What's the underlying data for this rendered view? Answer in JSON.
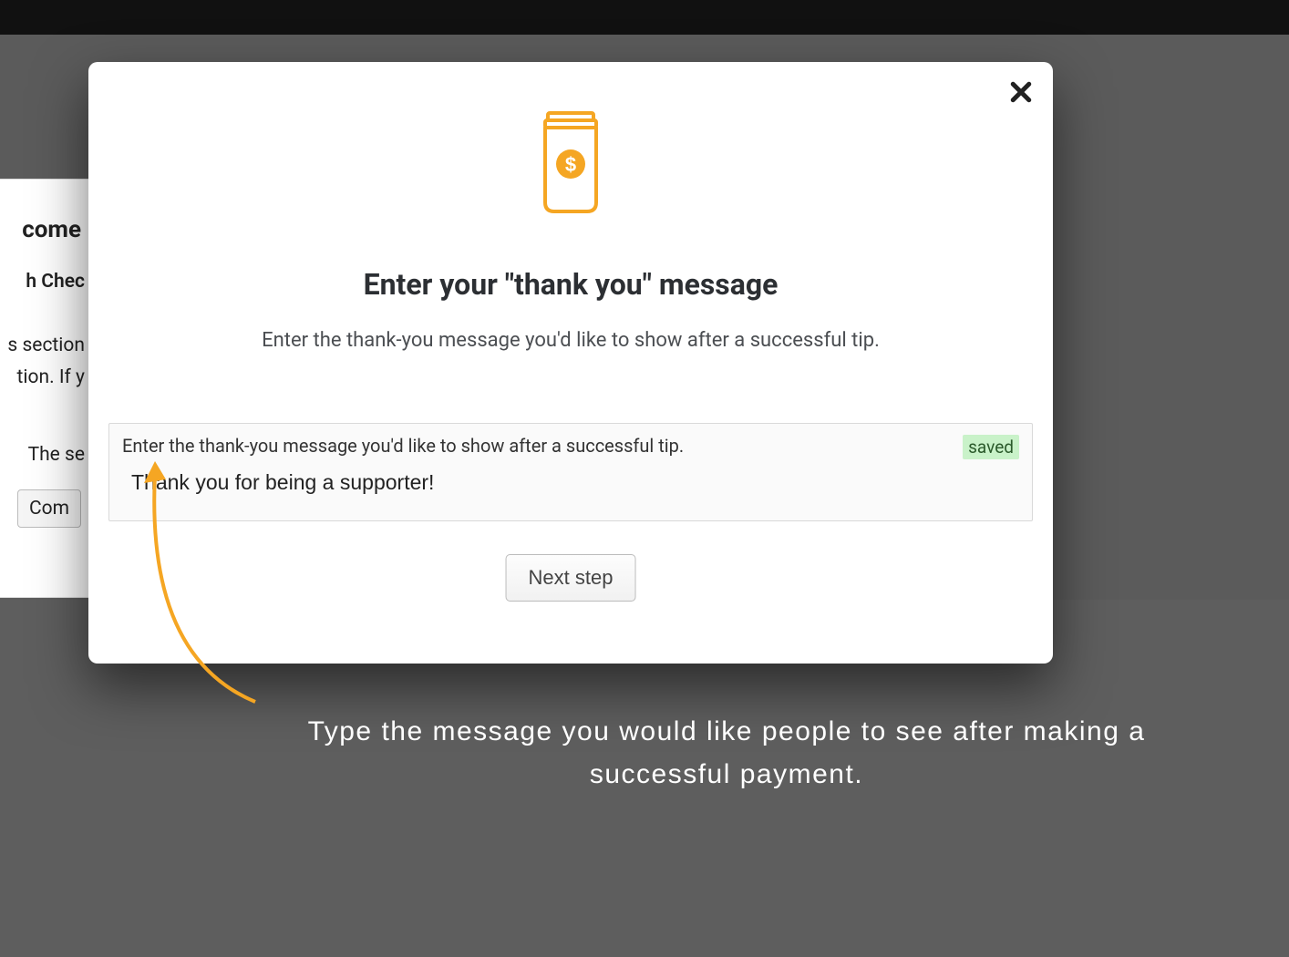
{
  "background": {
    "heading_fragment": "come",
    "row1_fragment": "h Chec",
    "row2_fragment": "s section",
    "row3_fragment": "tion. If y",
    "row4_fragment": "The se",
    "button_fragment": "Com"
  },
  "modal": {
    "title": "Enter your \"thank you\" message",
    "subtitle": "Enter the thank-you message you'd like to show after a successful tip.",
    "field_label": "Enter the thank-you message you'd like to show after a successful tip.",
    "saved_badge": "saved",
    "input_value": "Thank you for being a supporter!",
    "next_button": "Next step"
  },
  "annotation": {
    "text": "Type the message you would like people to see after making a successful payment."
  },
  "colors": {
    "accent": "#f5a623"
  }
}
